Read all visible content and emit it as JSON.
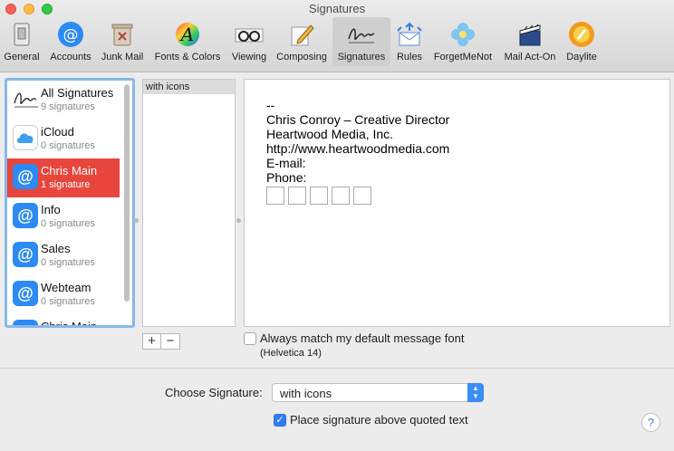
{
  "window": {
    "title": "Signatures"
  },
  "toolbar": {
    "items": [
      {
        "label": "General",
        "icon": "switch-icon"
      },
      {
        "label": "Accounts",
        "icon": "at-icon"
      },
      {
        "label": "Junk Mail",
        "icon": "trash-icon"
      },
      {
        "label": "Fonts & Colors",
        "icon": "fonts-icon"
      },
      {
        "label": "Viewing",
        "icon": "glasses-icon"
      },
      {
        "label": "Composing",
        "icon": "pencil-icon"
      },
      {
        "label": "Signatures",
        "icon": "signature-icon",
        "selected": true
      },
      {
        "label": "Rules",
        "icon": "rules-icon"
      },
      {
        "label": "ForgetMeNot",
        "icon": "flower-icon"
      },
      {
        "label": "Mail Act-On",
        "icon": "clapper-icon"
      },
      {
        "label": "Daylite",
        "icon": "daylite-icon"
      }
    ]
  },
  "accounts": [
    {
      "name": "All Signatures",
      "count": "9 signatures",
      "icon": "signature-icon"
    },
    {
      "name": "iCloud",
      "count": "0 signatures",
      "icon": "cloud-icon"
    },
    {
      "name": "Chris Main",
      "count": "1 signature",
      "icon": "at-icon",
      "selected": true
    },
    {
      "name": "Info",
      "count": "0 signatures",
      "icon": "at-icon"
    },
    {
      "name": "Sales",
      "count": "0 signatures",
      "icon": "at-icon"
    },
    {
      "name": "Webteam",
      "count": "0 signatures",
      "icon": "at-icon"
    },
    {
      "name": "Chris Main",
      "count": "",
      "icon": "at-icon"
    }
  ],
  "signatures": [
    {
      "name": "with icons"
    }
  ],
  "editor": {
    "lines": [
      "--",
      "Chris Conroy – Creative Director",
      "Heartwood Media, Inc.",
      "http://www.heartwoodmedia.com",
      "E-mail:",
      "Phone:"
    ]
  },
  "buttons": {
    "add": "+",
    "remove": "−"
  },
  "options": {
    "match_font_label": "Always match my default message font",
    "match_font_checked": false,
    "font_hint": "(Helvetica 14)",
    "choose_label": "Choose Signature:",
    "choose_value": "with icons",
    "place_above_label": "Place signature above quoted text",
    "place_above_checked": true
  },
  "help": "?",
  "colors": {
    "accent": "#2f7cf6",
    "selection": "#e8453c",
    "focus_ring": "#86b8ea"
  }
}
